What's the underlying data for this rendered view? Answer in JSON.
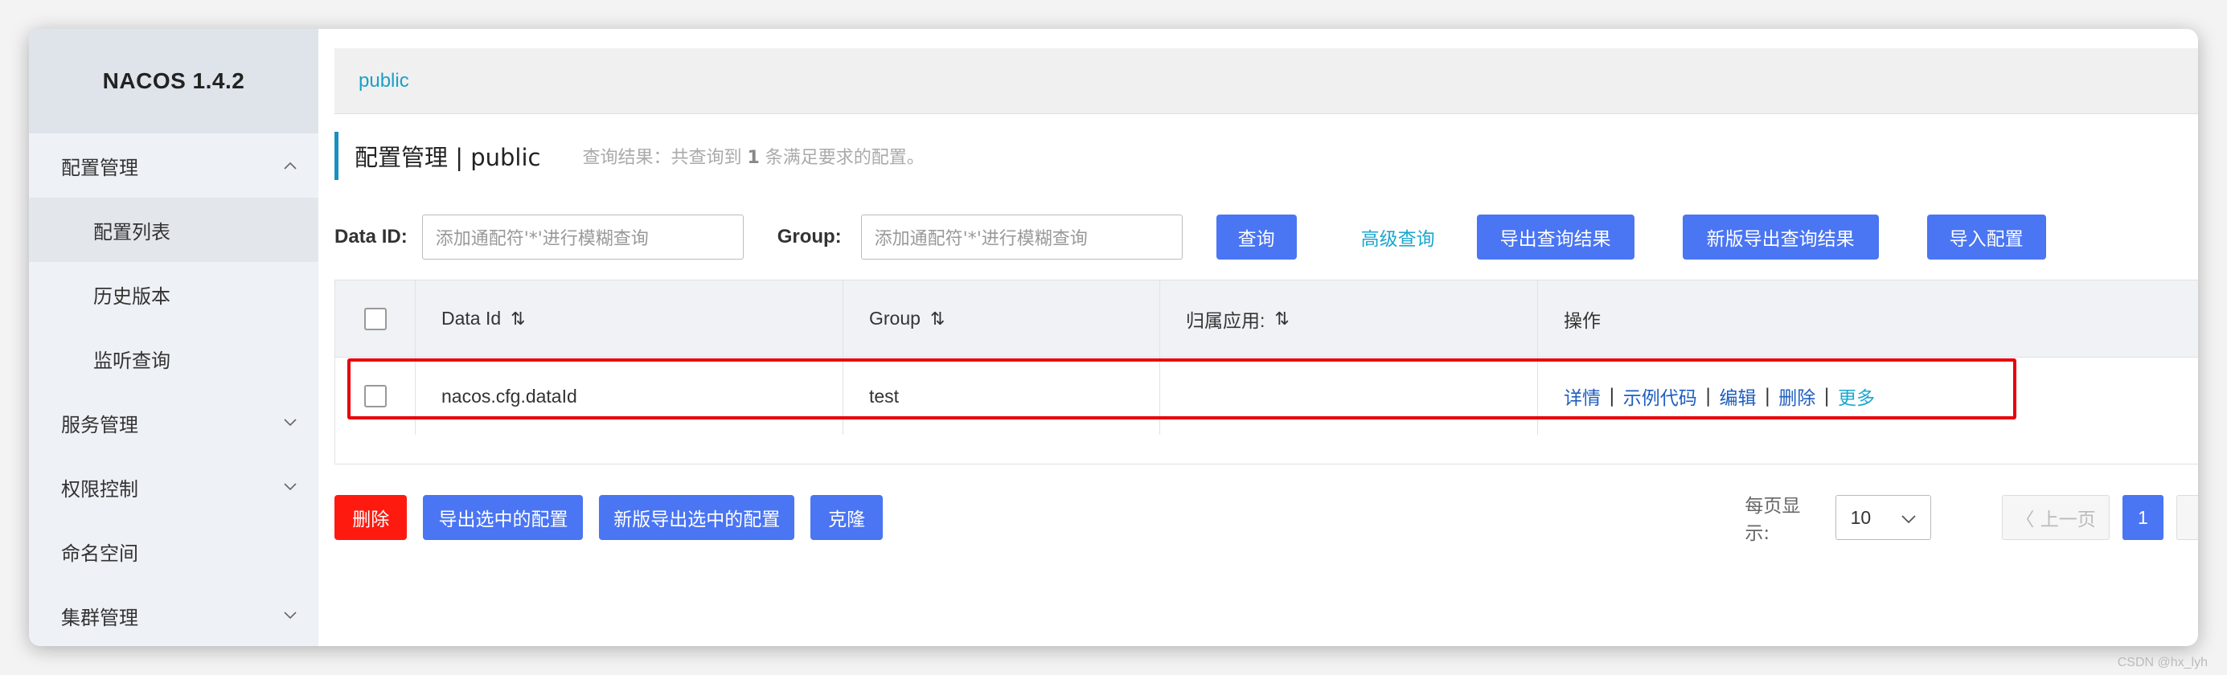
{
  "app": {
    "brand": "NACOS 1.4.2"
  },
  "sidebar": {
    "items": [
      {
        "label": "配置管理",
        "expanded": true,
        "chevron": "chevron-up-icon"
      },
      {
        "label": "配置列表",
        "sub": true,
        "active": true
      },
      {
        "label": "历史版本",
        "sub": true
      },
      {
        "label": "监听查询",
        "sub": true
      },
      {
        "label": "服务管理",
        "chevron": "chevron-down-icon"
      },
      {
        "label": "权限控制",
        "chevron": "chevron-down-icon"
      },
      {
        "label": "命名空间"
      },
      {
        "label": "集群管理",
        "chevron": "chevron-down-icon"
      }
    ]
  },
  "namespace_bar": {
    "label": "public"
  },
  "header": {
    "title": "配置管理 | public",
    "summary_prefix": "查询结果：共查询到 ",
    "summary_count": "1",
    "summary_suffix": " 条满足要求的配置。"
  },
  "search": {
    "dataid_label": "Data ID:",
    "dataid_placeholder": "添加通配符'*'进行模糊查询",
    "group_label": "Group:",
    "group_placeholder": "添加通配符'*'进行模糊查询",
    "query_button": "查询",
    "advanced_link": "高级查询",
    "export_button": "导出查询结果",
    "export_new_button": "新版导出查询结果",
    "import_button": "导入配置"
  },
  "table": {
    "headers": {
      "data_id": "Data Id",
      "group": "Group",
      "app": "归属应用:",
      "ops": "操作"
    },
    "rows": [
      {
        "data_id": "nacos.cfg.dataId",
        "group": "test",
        "app": "",
        "ops": [
          "详情",
          "示例代码",
          "编辑",
          "删除",
          "更多"
        ]
      }
    ]
  },
  "bottom": {
    "delete_button": "删除",
    "export_selected_button": "导出选中的配置",
    "export_selected_new_button": "新版导出选中的配置",
    "clone_button": "克隆",
    "page_size_label": "每页显示:",
    "page_size_value": "10",
    "prev_button": "〈 上一页",
    "current_page": "1"
  },
  "watermark": "CSDN @hx_lyh",
  "colors": {
    "primary": "#4a75f3",
    "danger": "#ff1a0f",
    "link": "#1f5ebf",
    "cyan": "#1aa7cf",
    "highlight": "#e8000c"
  }
}
